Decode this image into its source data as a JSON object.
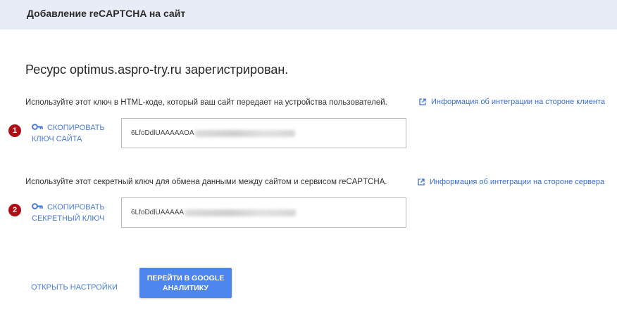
{
  "header": {
    "title": "Добавление reCAPTCHA на сайт"
  },
  "main": {
    "heading": "Ресурс optimus.aspro-try.ru зарегистрирован.",
    "site_key": {
      "badge": "1",
      "description": "Используйте этот ключ в HTML-коде, который ваш сайт передает на устройства пользователей.",
      "link": "Информация об интеграции на стороне клиента",
      "copy_line1": "СКОПИРОВАТЬ",
      "copy_line2": "КЛЮЧ САЙТА",
      "value_visible": "6LfoDdlUAAAAAOA"
    },
    "secret_key": {
      "badge": "2",
      "description": "Используйте этот секретный ключ для обмена данными между сайтом и сервисом reCAPTCHA.",
      "link": "Информация об интеграции на стороне сервера",
      "copy_line1": "СКОПИРОВАТЬ",
      "copy_line2": "СЕКРЕТНЫЙ КЛЮЧ",
      "value_visible": "6LfoDdlUAAAAA"
    },
    "settings_link": "ОТКРЫТЬ НАСТРОЙКИ",
    "analytics_button": "ПЕРЕЙТИ В GOOGLE АНАЛИТИКУ"
  },
  "icons": {
    "external": "open-in-new-icon",
    "key": "key-icon"
  },
  "colors": {
    "header_bg": "#e8ecf6",
    "link": "#3b6fd8",
    "badge": "#b00e16",
    "primary_button": "#4e86f0"
  }
}
